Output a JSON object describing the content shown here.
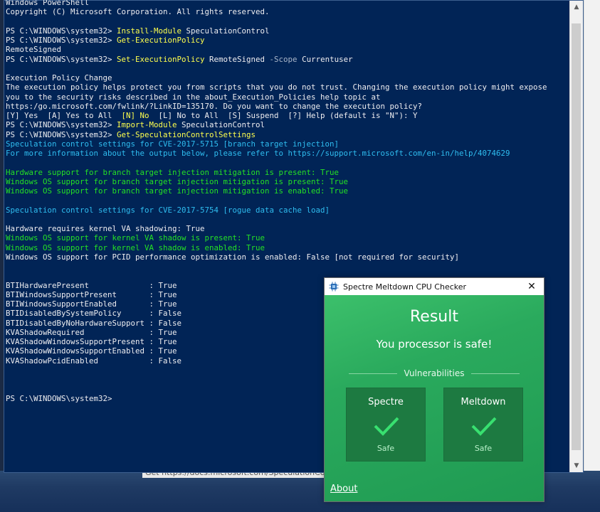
{
  "console": {
    "lines": [
      {
        "segments": [
          {
            "t": "Windows PowerShell",
            "c": "white"
          }
        ]
      },
      {
        "segments": [
          {
            "t": "Copyright (C) Microsoft Corporation. All rights reserved.",
            "c": "white"
          }
        ]
      },
      {
        "segments": []
      },
      {
        "segments": [
          {
            "t": "PS C:\\WINDOWS\\system32> ",
            "c": "white"
          },
          {
            "t": "Install-Module",
            "c": "yellow"
          },
          {
            "t": " SpeculationControl",
            "c": "white"
          }
        ]
      },
      {
        "segments": [
          {
            "t": "PS C:\\WINDOWS\\system32> ",
            "c": "white"
          },
          {
            "t": "Get-ExecutionPolicy",
            "c": "yellow"
          }
        ]
      },
      {
        "segments": [
          {
            "t": "RemoteSigned",
            "c": "white"
          }
        ]
      },
      {
        "segments": [
          {
            "t": "PS C:\\WINDOWS\\system32> ",
            "c": "white"
          },
          {
            "t": "Set-ExecutionPolicy",
            "c": "yellow"
          },
          {
            "t": " RemoteSigned ",
            "c": "white"
          },
          {
            "t": "-Scope",
            "c": "gray"
          },
          {
            "t": " Currentuser",
            "c": "white"
          }
        ]
      },
      {
        "segments": []
      },
      {
        "segments": [
          {
            "t": "Execution Policy Change",
            "c": "white"
          }
        ]
      },
      {
        "segments": [
          {
            "t": "The execution policy helps protect you from scripts that you do not trust. Changing the execution policy might expose",
            "c": "white"
          }
        ]
      },
      {
        "segments": [
          {
            "t": "you to the security risks described in the about_Execution_Policies help topic at",
            "c": "white"
          }
        ]
      },
      {
        "segments": [
          {
            "t": "https:/go.microsoft.com/fwlink/?LinkID=135170. Do you want to change the execution policy?",
            "c": "white"
          }
        ]
      },
      {
        "segments": [
          {
            "t": "[Y] Yes  [A] Yes to All  ",
            "c": "white"
          },
          {
            "t": "[N] No",
            "c": "yellow"
          },
          {
            "t": "  [L] No to All  [S] Suspend  [?] Help (default is \"N\"): Y",
            "c": "white"
          }
        ]
      },
      {
        "segments": [
          {
            "t": "PS C:\\WINDOWS\\system32> ",
            "c": "white"
          },
          {
            "t": "Import-Module",
            "c": "yellow"
          },
          {
            "t": " SpeculationControl",
            "c": "white"
          }
        ]
      },
      {
        "segments": [
          {
            "t": "PS C:\\WINDOWS\\system32> ",
            "c": "white"
          },
          {
            "t": "Get-SpeculationControlSettings",
            "c": "yellow"
          }
        ]
      },
      {
        "segments": [
          {
            "t": "Speculation control settings for CVE-2017-5715 [branch target injection]",
            "c": "cyan"
          }
        ]
      },
      {
        "segments": [
          {
            "t": "For more information about the output below, please refer to https://support.microsoft.com/en-in/help/4074629",
            "c": "cyan"
          }
        ]
      },
      {
        "segments": []
      },
      {
        "segments": [
          {
            "t": "Hardware support for branch target injection mitigation is present: True",
            "c": "green"
          }
        ]
      },
      {
        "segments": [
          {
            "t": "Windows OS support for branch target injection mitigation is present: True",
            "c": "green"
          }
        ]
      },
      {
        "segments": [
          {
            "t": "Windows OS support for branch target injection mitigation is enabled: True",
            "c": "green"
          }
        ]
      },
      {
        "segments": []
      },
      {
        "segments": [
          {
            "t": "Speculation control settings for CVE-2017-5754 [rogue data cache load]",
            "c": "cyan"
          }
        ]
      },
      {
        "segments": []
      },
      {
        "segments": [
          {
            "t": "Hardware requires kernel VA shadowing: True",
            "c": "white"
          }
        ]
      },
      {
        "segments": [
          {
            "t": "Windows OS support for kernel VA shadow is present: True",
            "c": "green"
          }
        ]
      },
      {
        "segments": [
          {
            "t": "Windows OS support for kernel VA shadow is enabled: True",
            "c": "green"
          }
        ]
      },
      {
        "segments": [
          {
            "t": "Windows OS support for PCID performance optimization is enabled: False [not required for security]",
            "c": "white"
          }
        ]
      },
      {
        "segments": []
      },
      {
        "segments": []
      },
      {
        "segments": [
          {
            "t": "BTIHardwarePresent             : True",
            "c": "white"
          }
        ]
      },
      {
        "segments": [
          {
            "t": "BTIWindowsSupportPresent       : True",
            "c": "white"
          }
        ]
      },
      {
        "segments": [
          {
            "t": "BTIWindowsSupportEnabled       : True",
            "c": "white"
          }
        ]
      },
      {
        "segments": [
          {
            "t": "BTIDisabledBySystemPolicy      : False",
            "c": "white"
          }
        ]
      },
      {
        "segments": [
          {
            "t": "BTIDisabledByNoHardwareSupport : False",
            "c": "white"
          }
        ]
      },
      {
        "segments": [
          {
            "t": "KVAShadowRequired              : True",
            "c": "white"
          }
        ]
      },
      {
        "segments": [
          {
            "t": "KVAShadowWindowsSupportPresent : True",
            "c": "white"
          }
        ]
      },
      {
        "segments": [
          {
            "t": "KVAShadowWindowsSupportEnabled : True",
            "c": "white"
          }
        ]
      },
      {
        "segments": [
          {
            "t": "KVAShadowPcidEnabled           : False",
            "c": "white"
          }
        ]
      },
      {
        "segments": []
      },
      {
        "segments": []
      },
      {
        "segments": []
      },
      {
        "segments": [
          {
            "t": "PS C:\\WINDOWS\\system32>",
            "c": "white"
          }
        ]
      }
    ]
  },
  "behind_window_text": "Get https://docs.microsoft.com/SpeculationControl",
  "checker": {
    "title": "Spectre Meltdown CPU Checker",
    "close_glyph": "✕",
    "result_title": "Result",
    "result_message": "You processor is safe!",
    "vulnerabilities_label": "Vulnerabilities",
    "cards": [
      {
        "name": "Spectre",
        "status": "Safe"
      },
      {
        "name": "Meltdown",
        "status": "Safe"
      }
    ],
    "about_label": "About"
  },
  "icons": {
    "app": "chip-icon",
    "close": "close-icon",
    "check": "checkmark-icon",
    "scroll_up": "scroll-up-icon",
    "scroll_down": "scroll-down-icon"
  },
  "colors": {
    "console_bg": "#012456",
    "command": "#ffff4d",
    "parameter": "#a8b5c8",
    "info": "#2fbdf0",
    "success": "#24e024",
    "checker_green": "#27a65a",
    "card_green": "#1d7a41"
  }
}
